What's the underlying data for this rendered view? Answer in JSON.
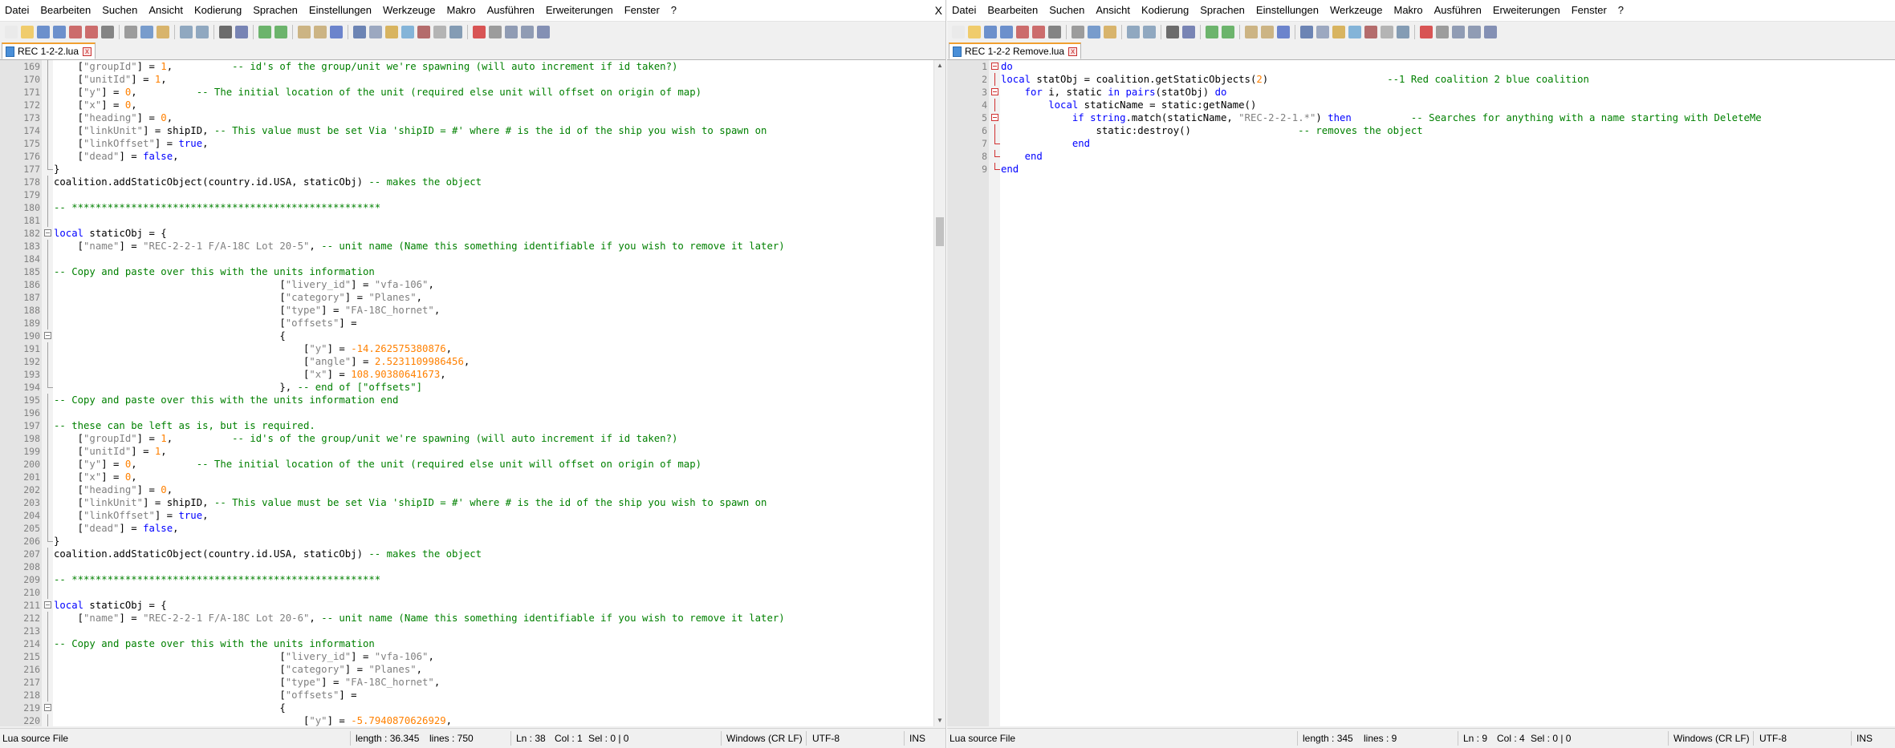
{
  "menu": [
    "Datei",
    "Bearbeiten",
    "Suchen",
    "Ansicht",
    "Kodierung",
    "Sprachen",
    "Einstellungen",
    "Werkzeuge",
    "Makro",
    "Ausführen",
    "Erweiterungen",
    "Fenster",
    "?"
  ],
  "close_glyph": "X",
  "tab_close_glyph": "x",
  "toolbar_icons": [
    "new-file-icon",
    "open-file-icon",
    "save-icon",
    "save-all-icon",
    "close-icon",
    "close-all-icon",
    "print-icon",
    "cut-icon",
    "copy-icon",
    "paste-icon",
    "undo-icon",
    "redo-icon",
    "find-icon",
    "replace-icon",
    "zoom-in-icon",
    "zoom-out-icon",
    "sync-vertical-icon",
    "sync-horizontal-icon",
    "word-wrap-icon",
    "show-all-chars-icon",
    "indent-guide-icon",
    "user-language-icon",
    "doc-map-icon",
    "function-list-icon",
    "folder-workspace-icon",
    "monitoring-icon",
    "record-macro-icon",
    "stop-recording-icon",
    "play-macro-icon",
    "run-macro-multiple-icon",
    "save-macro-icon"
  ],
  "left": {
    "tab_label": "REC 1-2-2.lua",
    "status": {
      "file_type": "Lua source File",
      "length": "length : 36.345",
      "lines": "lines : 750",
      "ln": "Ln : 38",
      "col": "Col : 1",
      "sel": "Sel : 0 | 0",
      "eol": "Windows (CR LF)",
      "encoding": "UTF-8",
      "mode": "INS"
    },
    "lines": [
      {
        "n": "169",
        "t": "    [\"groupId\"] = 1,          -- id's of the group/unit we're spawning (will auto increment if id taken?)"
      },
      {
        "n": "170",
        "t": "    [\"unitId\"] = 1,"
      },
      {
        "n": "171",
        "t": "    [\"y\"] = 0,          -- The initial location of the unit (required else unit will offset on origin of map)"
      },
      {
        "n": "172",
        "t": "    [\"x\"] = 0,"
      },
      {
        "n": "173",
        "t": "    [\"heading\"] = 0,"
      },
      {
        "n": "174",
        "t": "    [\"linkUnit\"] = shipID, -- This value must be set Via 'shipID = #' where # is the id of the ship you wish to spawn on"
      },
      {
        "n": "175",
        "t": "    [\"linkOffset\"] = true,"
      },
      {
        "n": "176",
        "t": "    [\"dead\"] = false,"
      },
      {
        "n": "177",
        "t": "}"
      },
      {
        "n": "178",
        "t": "coalition.addStaticObject(country.id.USA, staticObj) -- makes the object"
      },
      {
        "n": "179",
        "t": ""
      },
      {
        "n": "180",
        "t": "-- ****************************************************"
      },
      {
        "n": "181",
        "t": ""
      },
      {
        "n": "182",
        "t": "local staticObj = {"
      },
      {
        "n": "183",
        "t": "    [\"name\"] = \"REC-2-2-1 F/A-18C Lot 20-5\", -- unit name (Name this something identifiable if you wish to remove it later)"
      },
      {
        "n": "184",
        "t": ""
      },
      {
        "n": "185",
        "t": "-- Copy and paste over this with the units information"
      },
      {
        "n": "186",
        "t": "                                      [\"livery_id\"] = \"vfa-106\","
      },
      {
        "n": "187",
        "t": "                                      [\"category\"] = \"Planes\","
      },
      {
        "n": "188",
        "t": "                                      [\"type\"] = \"FA-18C_hornet\","
      },
      {
        "n": "189",
        "t": "                                      [\"offsets\"] ="
      },
      {
        "n": "190",
        "t": "                                      {"
      },
      {
        "n": "191",
        "t": "                                          [\"y\"] = -14.262575380876,"
      },
      {
        "n": "192",
        "t": "                                          [\"angle\"] = 2.5231109986456,"
      },
      {
        "n": "193",
        "t": "                                          [\"x\"] = 108.90380641673,"
      },
      {
        "n": "194",
        "t": "                                      }, -- end of [\"offsets\"]"
      },
      {
        "n": "195",
        "t": "-- Copy and paste over this with the units information end"
      },
      {
        "n": "196",
        "t": ""
      },
      {
        "n": "197",
        "t": "-- these can be left as is, but is required."
      },
      {
        "n": "198",
        "t": "    [\"groupId\"] = 1,          -- id's of the group/unit we're spawning (will auto increment if id taken?)"
      },
      {
        "n": "199",
        "t": "    [\"unitId\"] = 1,"
      },
      {
        "n": "200",
        "t": "    [\"y\"] = 0,          -- The initial location of the unit (required else unit will offset on origin of map)"
      },
      {
        "n": "201",
        "t": "    [\"x\"] = 0,"
      },
      {
        "n": "202",
        "t": "    [\"heading\"] = 0,"
      },
      {
        "n": "203",
        "t": "    [\"linkUnit\"] = shipID, -- This value must be set Via 'shipID = #' where # is the id of the ship you wish to spawn on"
      },
      {
        "n": "204",
        "t": "    [\"linkOffset\"] = true,"
      },
      {
        "n": "205",
        "t": "    [\"dead\"] = false,"
      },
      {
        "n": "206",
        "t": "}"
      },
      {
        "n": "207",
        "t": "coalition.addStaticObject(country.id.USA, staticObj) -- makes the object"
      },
      {
        "n": "208",
        "t": ""
      },
      {
        "n": "209",
        "t": "-- ****************************************************"
      },
      {
        "n": "210",
        "t": ""
      },
      {
        "n": "211",
        "t": "local staticObj = {"
      },
      {
        "n": "212",
        "t": "    [\"name\"] = \"REC-2-2-1 F/A-18C Lot 20-6\", -- unit name (Name this something identifiable if you wish to remove it later)"
      },
      {
        "n": "213",
        "t": ""
      },
      {
        "n": "214",
        "t": "-- Copy and paste over this with the units information"
      },
      {
        "n": "215",
        "t": "                                      [\"livery_id\"] = \"vfa-106\","
      },
      {
        "n": "216",
        "t": "                                      [\"category\"] = \"Planes\","
      },
      {
        "n": "217",
        "t": "                                      [\"type\"] = \"FA-18C_hornet\","
      },
      {
        "n": "218",
        "t": "                                      [\"offsets\"] ="
      },
      {
        "n": "219",
        "t": "                                      {"
      },
      {
        "n": "220",
        "t": "                                          [\"y\"] = -5.7940870626929,"
      }
    ]
  },
  "right": {
    "tab_label": "REC 1-2-2 Remove.lua",
    "status": {
      "file_type": "Lua source File",
      "length": "length : 345",
      "lines": "lines : 9",
      "ln": "Ln : 9",
      "col": "Col : 4",
      "sel": "Sel : 0 | 0",
      "eol": "Windows (CR LF)",
      "encoding": "UTF-8",
      "mode": "INS"
    },
    "lines": [
      {
        "n": "1",
        "t": "do"
      },
      {
        "n": "2",
        "t": "local statObj = coalition.getStaticObjects(2)                    --1 Red coalition 2 blue coalition"
      },
      {
        "n": "3",
        "t": "    for i, static in pairs(statObj) do"
      },
      {
        "n": "4",
        "t": "        local staticName = static:getName()"
      },
      {
        "n": "5",
        "t": "            if string.match(staticName, \"REC-2-2-1.*\") then          -- Searches for anything with a name starting with DeleteMe"
      },
      {
        "n": "6",
        "t": "                static:destroy()                  -- removes the object"
      },
      {
        "n": "7",
        "t": "            end"
      },
      {
        "n": "8",
        "t": "    end"
      },
      {
        "n": "9",
        "t": "end"
      }
    ]
  }
}
